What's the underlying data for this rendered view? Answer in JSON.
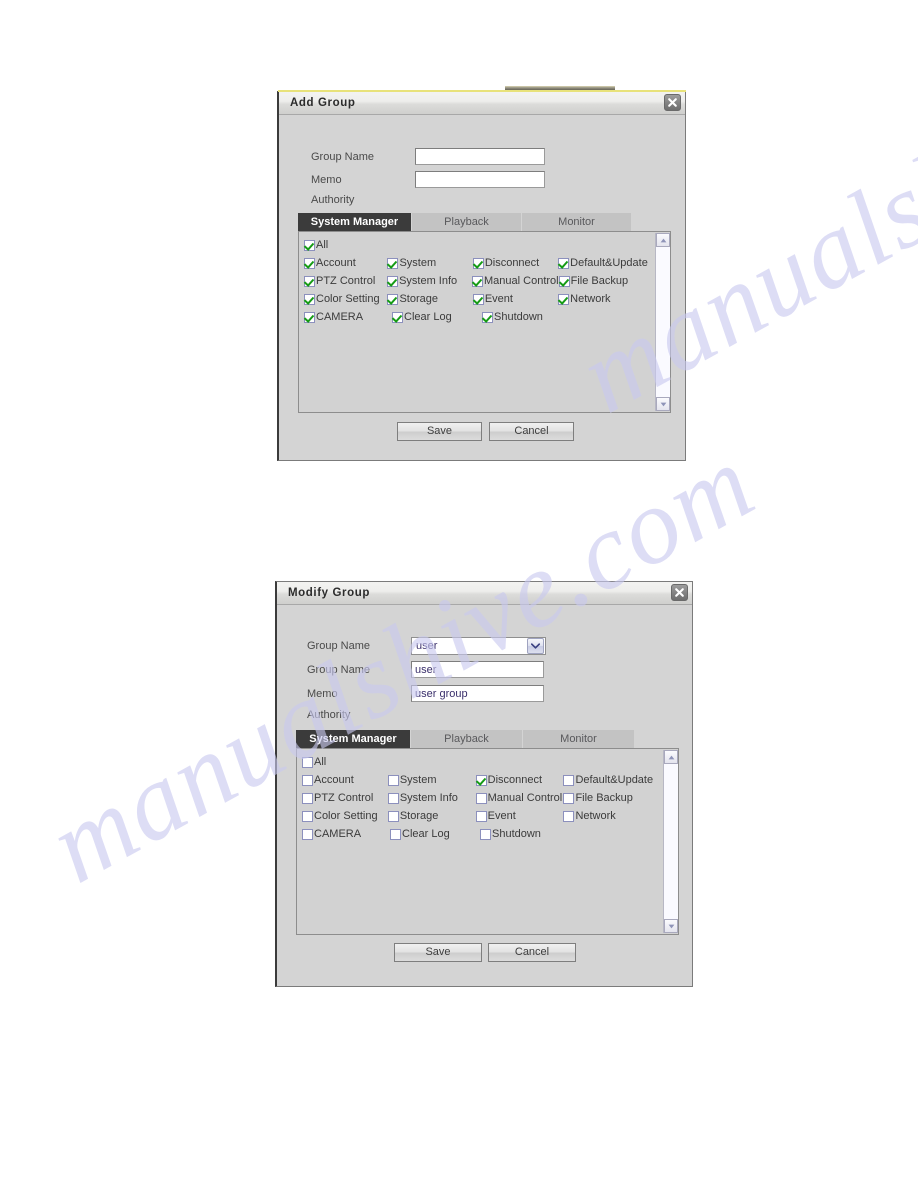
{
  "page": {
    "background": "#ffffff",
    "watermark_text": "manualshive.com",
    "watermark_color": "#c9c9ef"
  },
  "permission_labels": {
    "all": "All",
    "rows": [
      [
        "Account",
        "System",
        "Disconnect",
        "Default&Update"
      ],
      [
        "PTZ Control",
        "System Info",
        "Manual Control",
        "File Backup"
      ],
      [
        "Color Setting",
        "Storage",
        "Event",
        "Network"
      ],
      [
        "CAMERA",
        "Clear Log",
        "Shutdown",
        ""
      ]
    ]
  },
  "add_group_dialog": {
    "title": "Add Group",
    "close_icon": "close-icon",
    "fields": {
      "group_name_label": "Group Name",
      "group_name_value": "",
      "group_name_placeholder": "",
      "memo_label": "Memo",
      "memo_value": "",
      "memo_placeholder": "",
      "authority_label": "Authority"
    },
    "tabs": [
      {
        "label": "System Manager",
        "active": true
      },
      {
        "label": "Playback",
        "active": false
      },
      {
        "label": "Monitor",
        "active": false
      }
    ],
    "permissions": {
      "all_checked": true,
      "checked": [
        [
          true,
          true,
          true,
          true
        ],
        [
          true,
          true,
          true,
          true
        ],
        [
          true,
          true,
          true,
          true
        ],
        [
          true,
          true,
          true,
          false
        ]
      ]
    },
    "scrollbar": {
      "up_icon": "caret-up-icon",
      "down_icon": "caret-down-icon"
    },
    "buttons": {
      "save": "Save",
      "cancel": "Cancel"
    }
  },
  "modify_group_dialog": {
    "title": "Modify Group",
    "close_icon": "close-icon",
    "fields": {
      "group_select_label": "Group Name",
      "group_select_value": "user",
      "group_select_options": [
        "user"
      ],
      "group_name_label": "Group Name",
      "group_name_value": "user",
      "memo_label": "Memo",
      "memo_value": "user group",
      "authority_label": "Authority"
    },
    "tabs": [
      {
        "label": "System Manager",
        "active": true
      },
      {
        "label": "Playback",
        "active": false
      },
      {
        "label": "Monitor",
        "active": false
      }
    ],
    "permissions": {
      "all_checked": false,
      "checked": [
        [
          false,
          false,
          true,
          false
        ],
        [
          false,
          false,
          false,
          false
        ],
        [
          false,
          false,
          false,
          false
        ],
        [
          false,
          false,
          false,
          false
        ]
      ]
    },
    "scrollbar": {
      "up_icon": "caret-up-icon",
      "down_icon": "caret-down-icon"
    },
    "buttons": {
      "save": "Save",
      "cancel": "Cancel"
    }
  }
}
